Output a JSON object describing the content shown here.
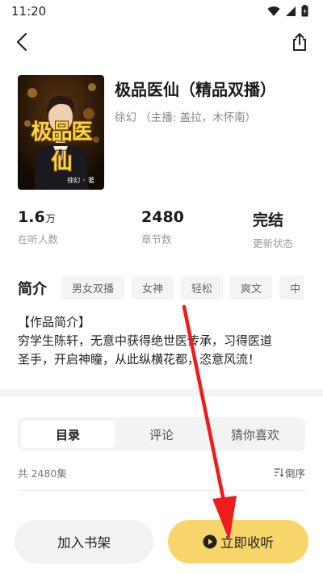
{
  "status_bar": {
    "time": "11:20",
    "icons": [
      "wifi-icon",
      "signal-icon",
      "battery-icon"
    ]
  },
  "nav": {
    "back_icon": "chevron-left-icon",
    "share_icon": "share-icon"
  },
  "book": {
    "title": "极品医仙（精品双播）",
    "meta": "徐幻   （主播: 盖拉，木怀南）",
    "cover_title": "极品医仙",
    "cover_author": "徐幻 ◦ 著"
  },
  "stats": [
    {
      "value": "1.6",
      "unit": "万",
      "label": "在听人数"
    },
    {
      "value": "2480",
      "unit": "",
      "label": "章节数"
    },
    {
      "value": "完结",
      "unit": "",
      "label": "更新状态"
    }
  ],
  "intro": {
    "label": "简介",
    "tags": [
      "男女双播",
      "女神",
      "轻松",
      "爽文",
      "中"
    ],
    "text_line1": "【作品简介】",
    "text_line2": "穷学生陈轩，无意中获得绝世医传承，习得医道",
    "text_line3": "圣手，开启神瞳，从此纵横花都，恣意风流！"
  },
  "tabs": [
    {
      "label": "目录",
      "active": true
    },
    {
      "label": "评论",
      "active": false
    },
    {
      "label": "猜你喜欢",
      "active": false
    }
  ],
  "episodes": {
    "count": "共 2480集",
    "sort_label": "倒序"
  },
  "bottom": {
    "shelf_label": "加入书架",
    "listen_label": "立即收听"
  },
  "colors": {
    "accent": "#f8d56b",
    "annotation_arrow": "#ee1c1c"
  }
}
